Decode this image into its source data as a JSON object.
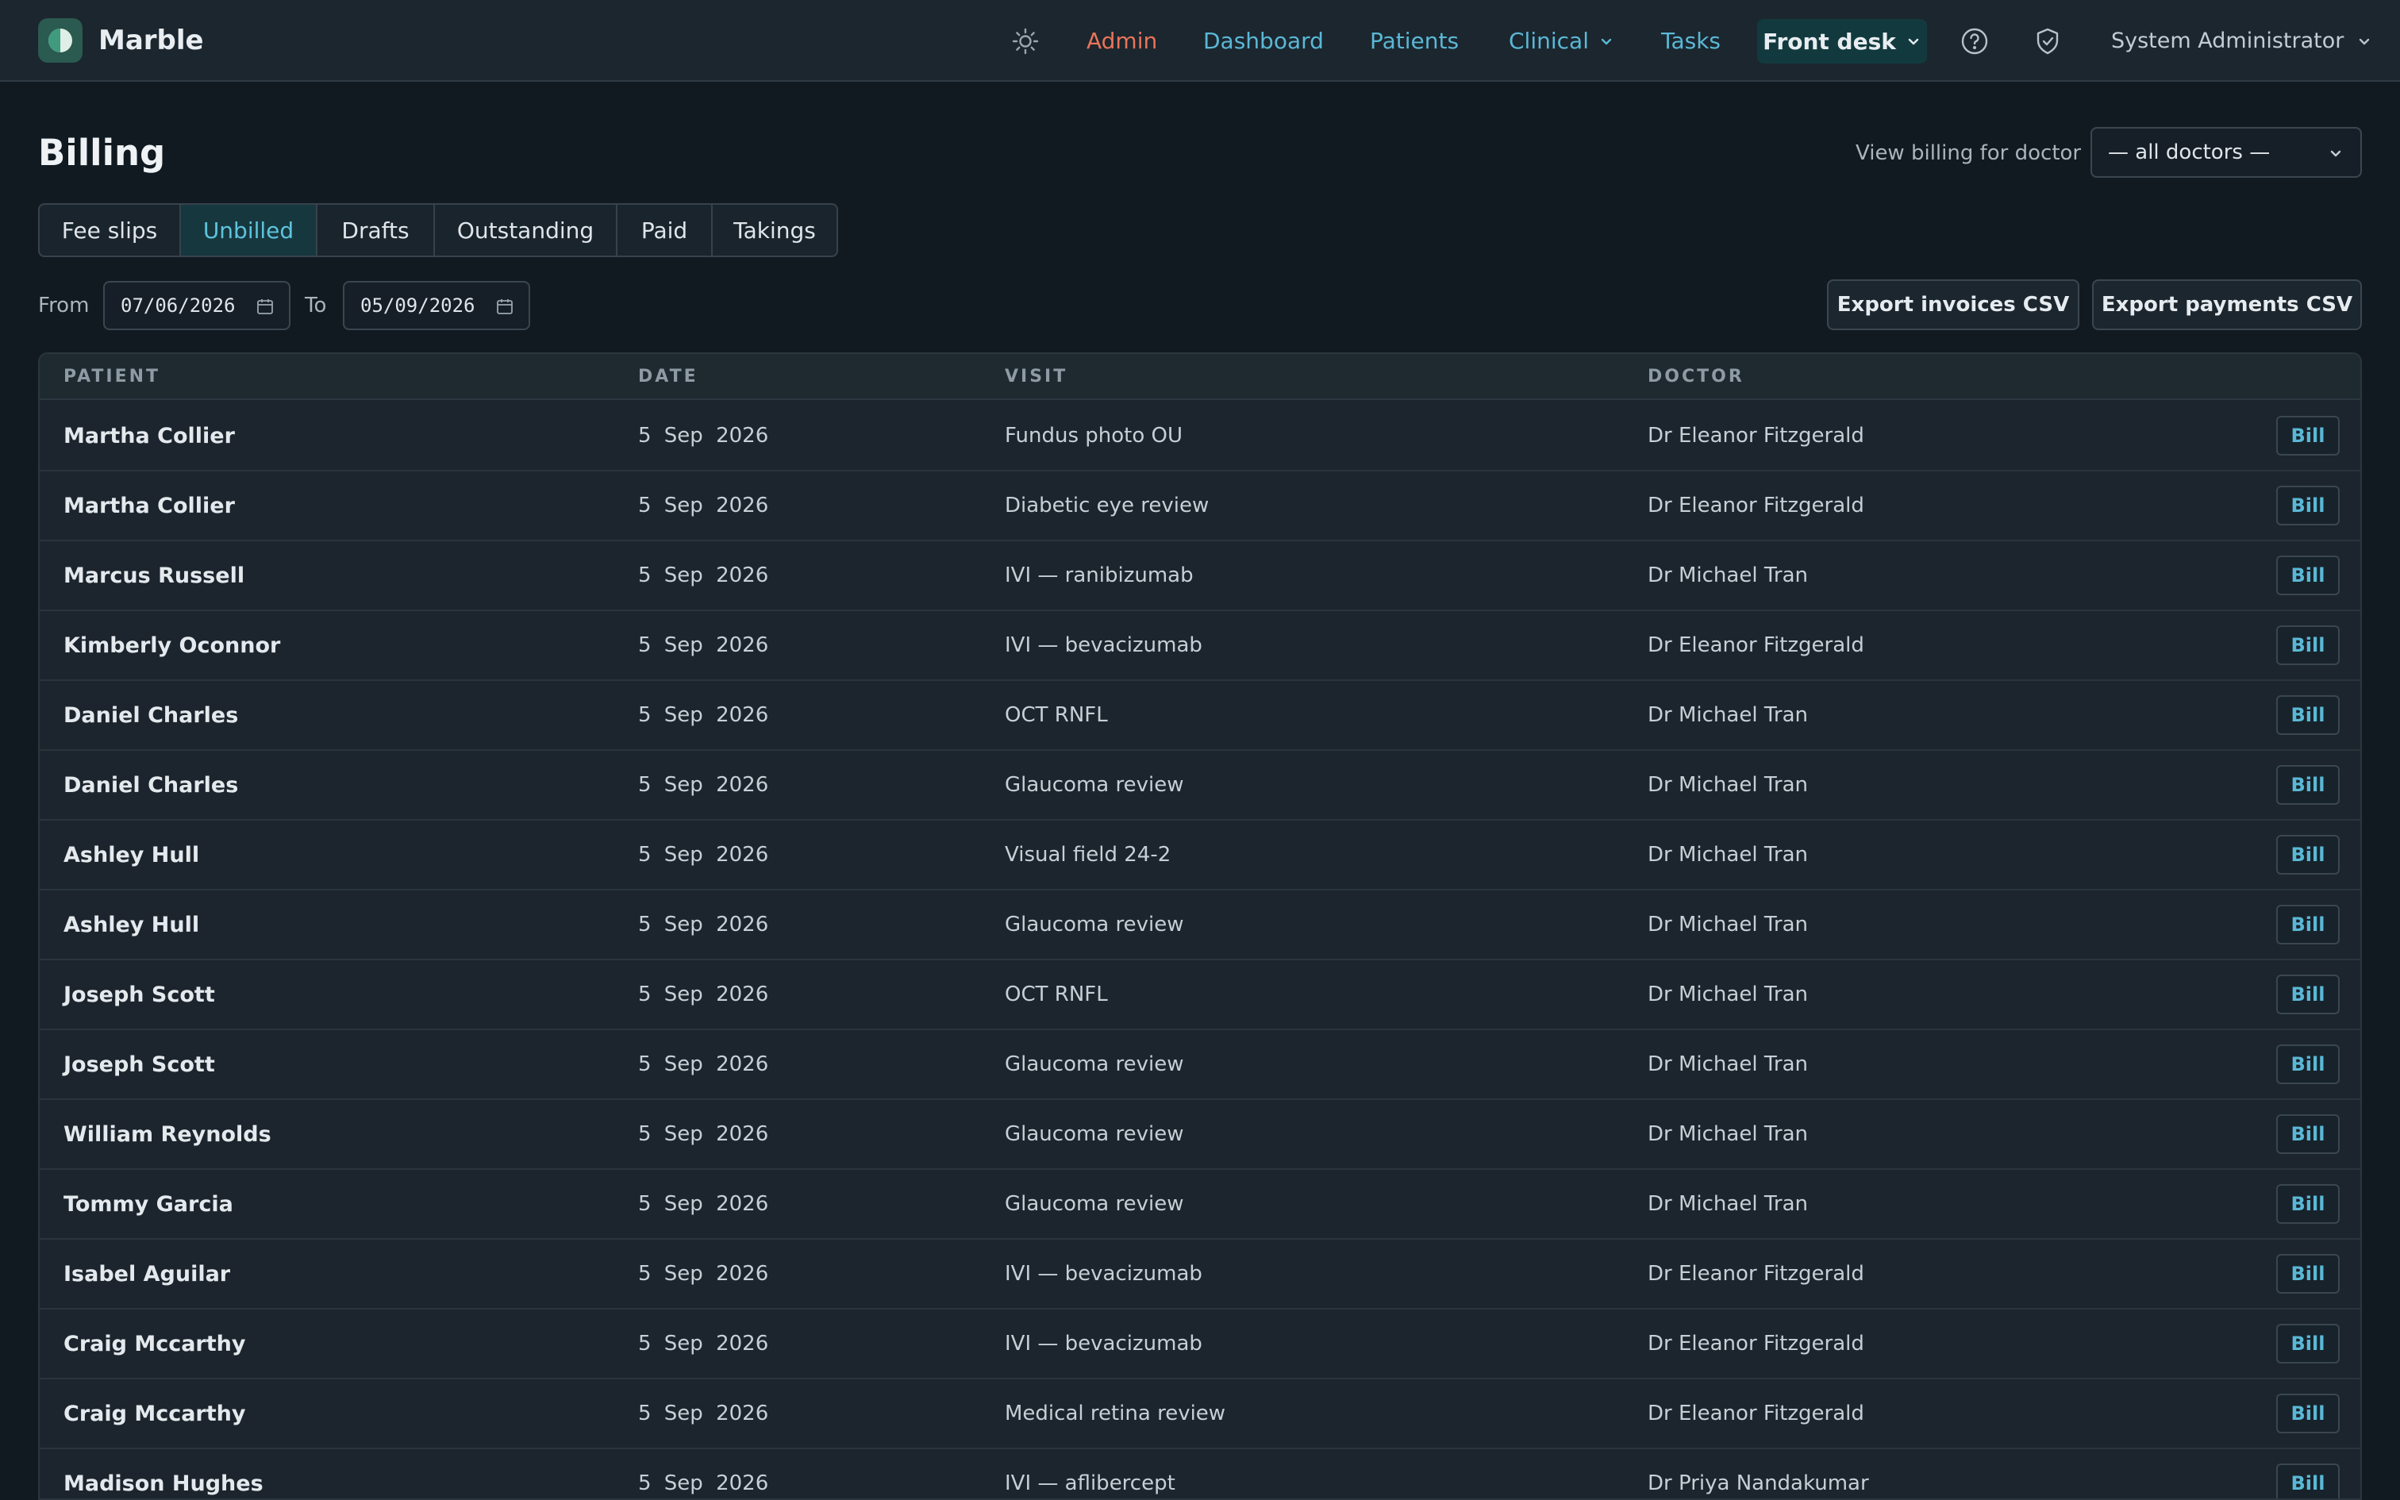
{
  "app": {
    "name": "Marble"
  },
  "nav": {
    "admin": "Admin",
    "dashboard": "Dashboard",
    "patients": "Patients",
    "clinical": "Clinical",
    "tasks": "Tasks",
    "front_desk": "Front desk",
    "user": "System Administrator"
  },
  "page": {
    "title": "Billing",
    "doctor_filter_label": "View billing for doctor",
    "doctor_filter_value": "— all doctors —"
  },
  "tabs": [
    "Fee slips",
    "Unbilled",
    "Drafts",
    "Outstanding",
    "Paid",
    "Takings"
  ],
  "active_tab": "Unbilled",
  "range": {
    "from_label": "From",
    "from_value": "07/06/2026",
    "to_label": "To",
    "to_value": "05/09/2026"
  },
  "actions": {
    "export_invoices": "Export invoices CSV",
    "export_payments": "Export payments CSV"
  },
  "table": {
    "headers": {
      "patient": "PATIENT",
      "date": "DATE",
      "visit": "VISIT",
      "doctor": "DOCTOR"
    },
    "bill_label": "Bill",
    "rows": [
      {
        "patient": "Martha Collier",
        "date": "5 Sep 2026",
        "visit": "Fundus photo OU",
        "doctor": "Dr Eleanor Fitzgerald"
      },
      {
        "patient": "Martha Collier",
        "date": "5 Sep 2026",
        "visit": "Diabetic eye review",
        "doctor": "Dr Eleanor Fitzgerald"
      },
      {
        "patient": "Marcus Russell",
        "date": "5 Sep 2026",
        "visit": "IVI — ranibizumab",
        "doctor": "Dr Michael Tran"
      },
      {
        "patient": "Kimberly Oconnor",
        "date": "5 Sep 2026",
        "visit": "IVI — bevacizumab",
        "doctor": "Dr Eleanor Fitzgerald"
      },
      {
        "patient": "Daniel Charles",
        "date": "5 Sep 2026",
        "visit": "OCT RNFL",
        "doctor": "Dr Michael Tran"
      },
      {
        "patient": "Daniel Charles",
        "date": "5 Sep 2026",
        "visit": "Glaucoma review",
        "doctor": "Dr Michael Tran"
      },
      {
        "patient": "Ashley Hull",
        "date": "5 Sep 2026",
        "visit": "Visual field 24-2",
        "doctor": "Dr Michael Tran"
      },
      {
        "patient": "Ashley Hull",
        "date": "5 Sep 2026",
        "visit": "Glaucoma review",
        "doctor": "Dr Michael Tran"
      },
      {
        "patient": "Joseph Scott",
        "date": "5 Sep 2026",
        "visit": "OCT RNFL",
        "doctor": "Dr Michael Tran"
      },
      {
        "patient": "Joseph Scott",
        "date": "5 Sep 2026",
        "visit": "Glaucoma review",
        "doctor": "Dr Michael Tran"
      },
      {
        "patient": "William Reynolds",
        "date": "5 Sep 2026",
        "visit": "Glaucoma review",
        "doctor": "Dr Michael Tran"
      },
      {
        "patient": "Tommy Garcia",
        "date": "5 Sep 2026",
        "visit": "Glaucoma review",
        "doctor": "Dr Michael Tran"
      },
      {
        "patient": "Isabel Aguilar",
        "date": "5 Sep 2026",
        "visit": "IVI — bevacizumab",
        "doctor": "Dr Eleanor Fitzgerald"
      },
      {
        "patient": "Craig Mccarthy",
        "date": "5 Sep 2026",
        "visit": "IVI — bevacizumab",
        "doctor": "Dr Eleanor Fitzgerald"
      },
      {
        "patient": "Craig Mccarthy",
        "date": "5 Sep 2026",
        "visit": "Medical retina review",
        "doctor": "Dr Eleanor Fitzgerald"
      },
      {
        "patient": "Madison Hughes",
        "date": "5 Sep 2026",
        "visit": "IVI — aflibercept",
        "doctor": "Dr Priya Nandakumar"
      }
    ]
  },
  "colors": {
    "accent": "#5ab8d6",
    "admin": "#e8745a",
    "background": "#111a21"
  }
}
